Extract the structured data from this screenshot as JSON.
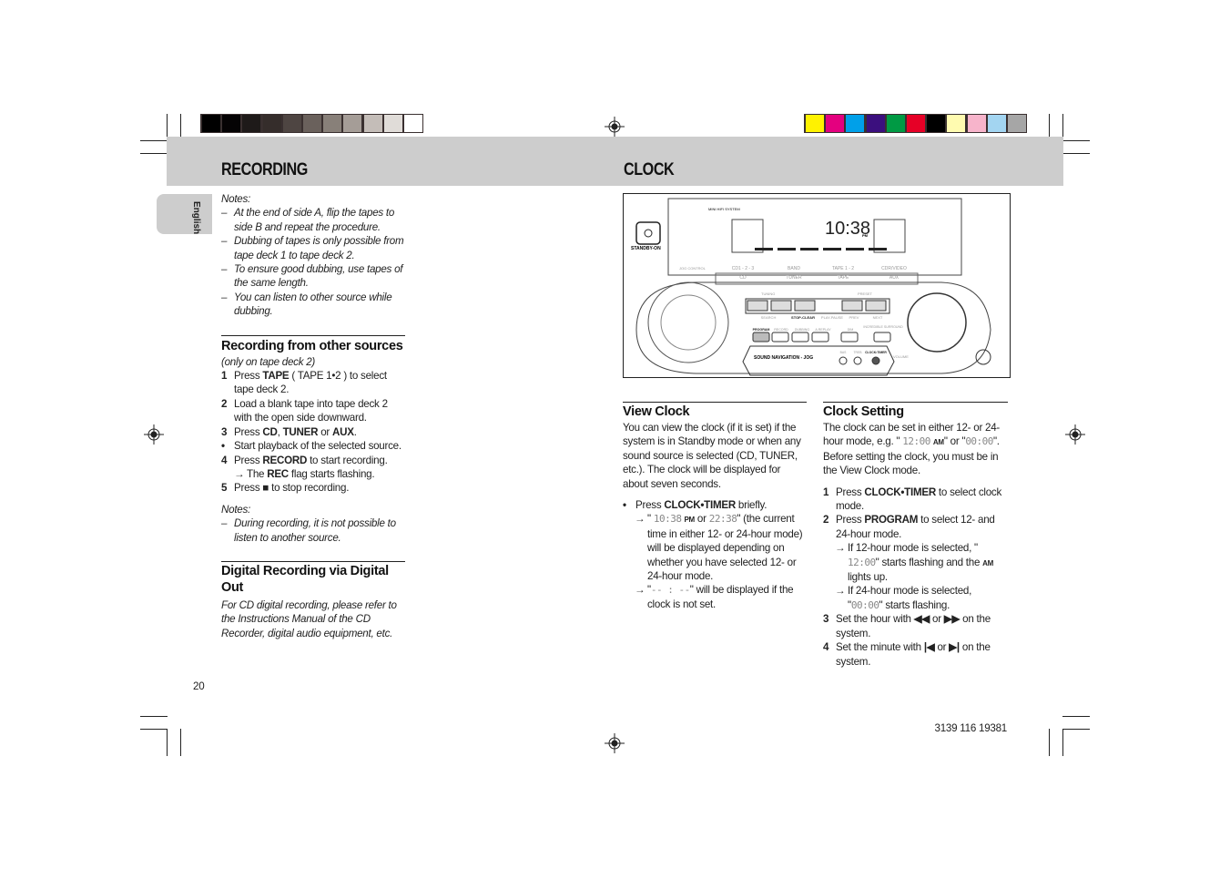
{
  "colors": {
    "band": "#cdcdcd",
    "gray_bars": [
      "#000000",
      "#050304",
      "#1e1a19",
      "#352d2b",
      "#4e4542",
      "#6a615c",
      "#888079",
      "#a59d97",
      "#c4bdb8",
      "#e0dcd8",
      "#ffffff"
    ],
    "color_bars": [
      "#fff200",
      "#e4007f",
      "#00a0e9",
      "#3b0f7e",
      "#009a44",
      "#e60026",
      "#000000",
      "#fffbb0",
      "#f7b4cb",
      "#a3d5f1",
      "#a6a6a6"
    ]
  },
  "language_tab": "English",
  "recording": {
    "title": "RECORDING",
    "notes1": {
      "label": "Notes:",
      "items": [
        "At the end of side A, flip the tapes to side B and repeat the procedure.",
        "Dubbing of tapes is only possible from tape deck 1 to tape deck 2.",
        "To ensure good dubbing, use tapes of the same length.",
        "You can listen to other source while dubbing."
      ]
    },
    "other": {
      "heading": "Recording from other sources",
      "subtitle": "(only on tape deck 2)",
      "s1": {
        "n": "1",
        "a": "Press ",
        "b": "TAPE",
        "c": " ( TAPE 1•2 ) to select tape deck 2."
      },
      "s2": {
        "n": "2",
        "a": "Load a blank tape into tape deck 2 with the open side downward."
      },
      "s3": {
        "n": "3",
        "a": "Press ",
        "b": "CD",
        "c": ", ",
        "d": "TUNER",
        "e": " or ",
        "f": "AUX",
        "g": "."
      },
      "s3b": {
        "n": "•",
        "a": "Start playback of the selected source."
      },
      "s4": {
        "n": "4",
        "a": "Press ",
        "b": "RECORD",
        "c": " to start recording."
      },
      "s4b": {
        "n": "→",
        "a": "The ",
        "b": "REC",
        "c": " flag starts flashing."
      },
      "s5": {
        "n": "5",
        "a": "Press ",
        "b": "■",
        "c": "  to stop recording."
      }
    },
    "notes2": {
      "label": "Notes:",
      "items": [
        "During recording, it is not possible to listen to another source."
      ]
    },
    "digital": {
      "heading": "Digital Recording via Digital Out",
      "text": "For CD digital recording, please refer to the Instructions Manual of the CD Recorder, digital audio equipment, etc."
    }
  },
  "clock": {
    "title": "CLOCK",
    "device": {
      "brand_line": "MINI HIFI SYSTEM",
      "standby": "STANDBY-ON",
      "display_time": "10:38",
      "display_pm": "PM",
      "jog": "JOG CONTROL",
      "sources_top": [
        "CD1 - 2 - 3",
        "BAND",
        "TAPE 1 - 2",
        "CDR/VIDEO"
      ],
      "sources": [
        "CD",
        "TUNER",
        "TAPE",
        "AUX"
      ],
      "tuning": "TUNING",
      "preset": "PRESET",
      "transport": [
        "SEARCH",
        "STOP-CLEAR",
        "PLAY-PAUSE",
        "PREV",
        "NEXT"
      ],
      "buttons": [
        "PROGRAM",
        "RECORD",
        "DUBBING",
        "A.REPLAY",
        "DIM",
        "INCREDIBLE SURROUND"
      ],
      "nav": "SOUND NAVIGATION - JOG",
      "knobs": [
        "BAS",
        "TREB",
        "CLOCK•TIMER"
      ],
      "volume": "VOLUME"
    },
    "view": {
      "heading": "View Clock",
      "text": "You can view the clock (if it is set) if the system is in Standby mode or when any sound source is selected (CD, TUNER, etc.). The clock will be displayed for about seven seconds.",
      "b1": {
        "n": "•",
        "a": "Press ",
        "b": "CLOCK•TIMER",
        "c": " briefly."
      },
      "r1": {
        "n": "→",
        "a": "\" ",
        "seg1": "10:38",
        "pm": "PM",
        "or": " or ",
        "seg2": "22:38",
        "c": "\" (the current time in either 12- or 24-hour mode) will be displayed depending on whether you have selected 12- or 24-hour mode."
      },
      "r2": {
        "n": "→",
        "a": "\"",
        "seg": "-- : --",
        "c": "\" will be displayed if the clock is not set."
      }
    },
    "setting": {
      "heading": "Clock Setting",
      "p": {
        "a": "The clock can be set in either 12- or 24-hour mode, e.g. \" ",
        "seg1": "12:00",
        "am": "AM",
        "b": "\" or \"",
        "seg2": "00:00",
        "c": "\". Before setting the clock, you must be in the View Clock mode."
      },
      "s1": {
        "n": "1",
        "a": "Press ",
        "b": "CLOCK•TIMER",
        "c": " to select clock mode."
      },
      "s2": {
        "n": "2",
        "a": "Press ",
        "b": "PROGRAM",
        "c": " to select 12- and 24-hour mode."
      },
      "s2a": {
        "n": "→",
        "a": "If 12-hour mode is selected, \" ",
        "seg": "12:00",
        "c": "\" starts flashing and the ",
        "am": "AM",
        "d": " lights up."
      },
      "s2b": {
        "n": "→",
        "a": "If 24-hour mode is selected, \"",
        "seg": "00:00",
        "c": "\" starts flashing."
      },
      "s3": {
        "n": "3",
        "a": "Set the hour with ",
        "b": "◀◀",
        "c": " or ",
        "d": "▶▶",
        "e": "  on the system."
      },
      "s4": {
        "n": "4",
        "a": "Set the minute with  ",
        "b": "|◀",
        "c": "  or  ",
        "d": "▶|",
        "e": " on the system."
      }
    }
  },
  "footer": {
    "page_number": "20",
    "doc_code": "3139 116 19381"
  }
}
